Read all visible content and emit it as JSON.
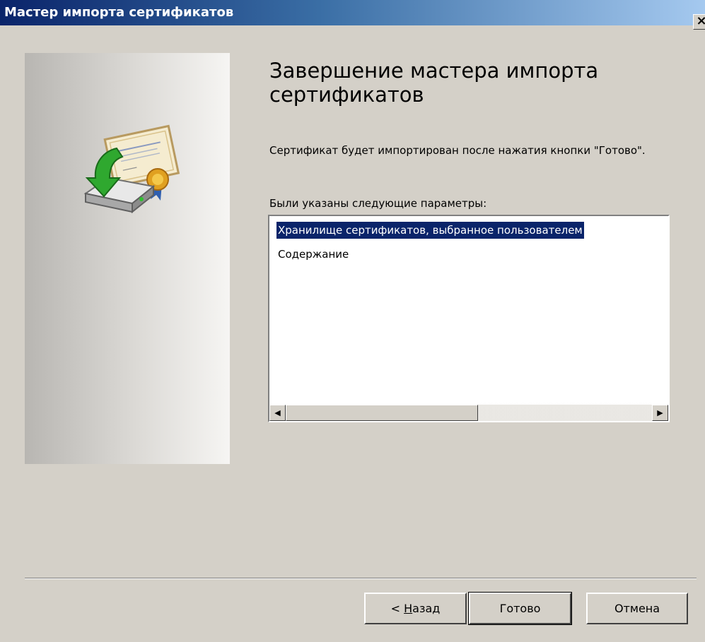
{
  "window": {
    "title": "Мастер импорта сертификатов",
    "close_glyph": "×"
  },
  "side": {
    "icon": "certificate-import-icon"
  },
  "content": {
    "heading": "Завершение мастера импорта сертификатов",
    "info": "Сертификат будет импортирован после нажатия кнопки \"Готово\".",
    "params_label": "Были указаны следующие параметры:",
    "list_items": [
      "Хранилище сертификатов, выбранное пользователем",
      "Содержание"
    ],
    "scroll_left_glyph": "◀",
    "scroll_right_glyph": "▶"
  },
  "buttons": {
    "back_prefix": "< ",
    "back_mnemonic": "Н",
    "back_rest": "азад",
    "finish": "Готово",
    "cancel": "Отмена"
  },
  "colors": {
    "selection": "#0a246a",
    "face": "#d4d0c8"
  }
}
